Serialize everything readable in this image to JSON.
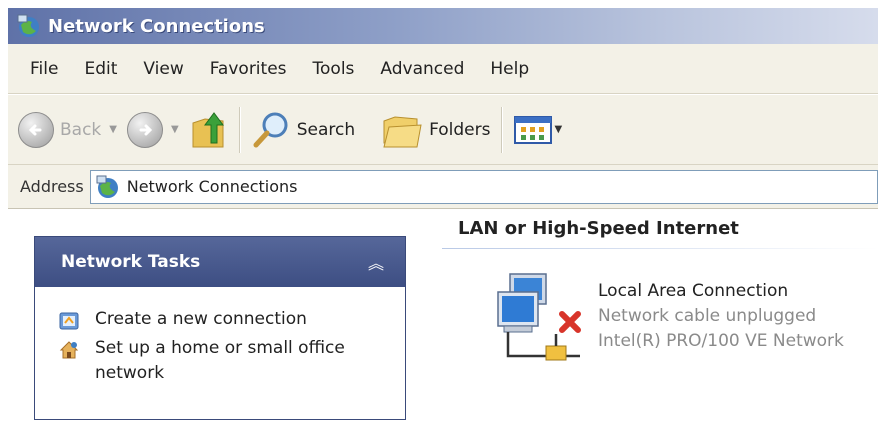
{
  "window": {
    "title": "Network Connections",
    "icon": "network-connections-icon"
  },
  "menu": [
    "File",
    "Edit",
    "View",
    "Favorites",
    "Tools",
    "Advanced",
    "Help"
  ],
  "toolbar": {
    "back_label": "Back",
    "search_label": "Search",
    "folders_label": "Folders"
  },
  "address": {
    "label": "Address",
    "value": "Network Connections"
  },
  "task_pane": {
    "title": "Network Tasks",
    "items": [
      {
        "label": "Create a new connection",
        "icon": "new-connection-icon"
      },
      {
        "label": "Set up a home or small office network",
        "icon": "home-network-icon"
      }
    ]
  },
  "content": {
    "group_title": "LAN or High-Speed Internet",
    "connection": {
      "name": "Local Area Connection",
      "status": "Network cable unplugged",
      "device": "Intel(R) PRO/100 VE Network"
    }
  },
  "colors": {
    "titlebar_start": "#5f72a8",
    "task_header": "#3d4e83",
    "chrome_bg": "#f3f1e7",
    "status_gray": "#8a8a8a",
    "error_red": "#d8342a"
  }
}
